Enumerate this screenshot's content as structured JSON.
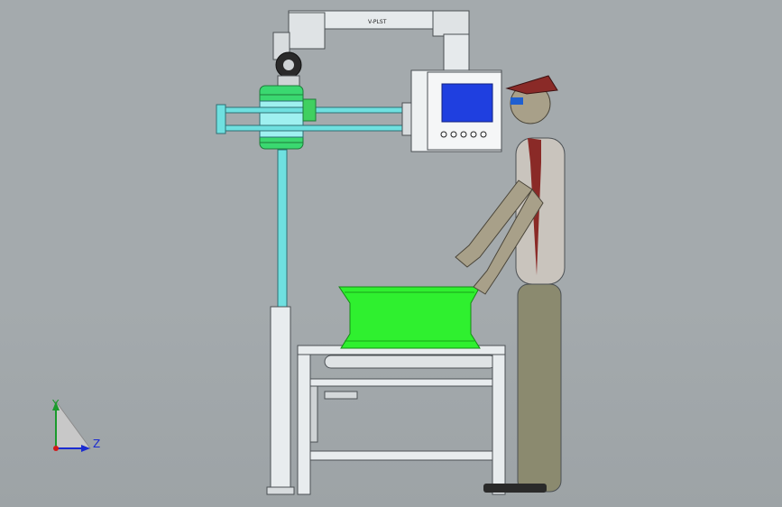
{
  "viewport": {
    "background": "#a4aaad"
  },
  "scene": {
    "duct_label": "V-PLST",
    "colors": {
      "wheel": "#2ff02f",
      "wheel_dark": "#17b817",
      "column": "#6fe0e0",
      "frame": "#e8ecee",
      "screen": "#1f3fe0",
      "operator_body": "#c9c4bd",
      "operator_pants": "#8b8a6f",
      "operator_hat": "#8a2a27",
      "operator_skin": "#a8a089"
    }
  },
  "triad": {
    "y_label": "Y",
    "z_label": "Z",
    "y_color": "#1a9a2c",
    "z_color": "#1b2bd0",
    "origin_color": "#d11a1a"
  }
}
